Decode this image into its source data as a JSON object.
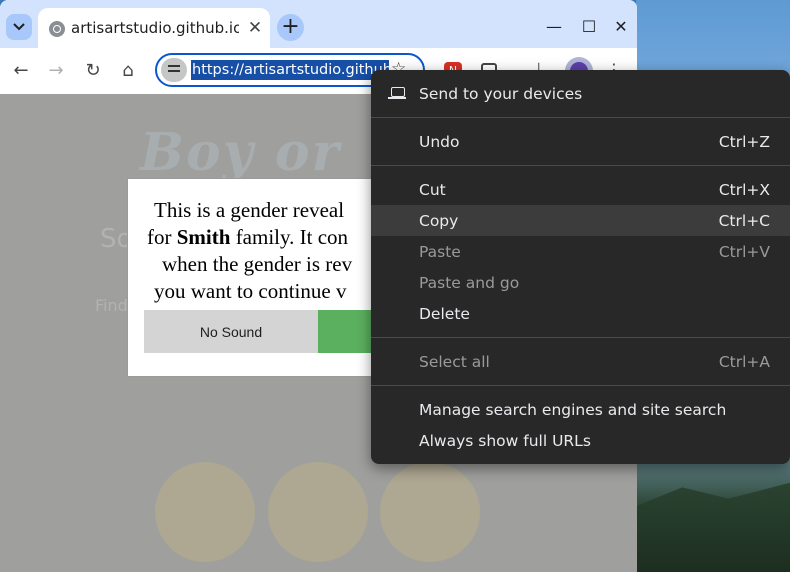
{
  "browser": {
    "tab": {
      "title": "artisartstudio.github.io/",
      "close_glyph": "✕"
    },
    "new_tab_glyph": "+",
    "window_controls": {
      "minimize": "—",
      "maximize": "☐",
      "close": "✕"
    },
    "nav": {
      "back": "←",
      "forward": "→",
      "reload": "↻",
      "home": "⌂"
    },
    "omnibox": {
      "url": "https://artisartstudio.github.io"
    },
    "icons": [
      "tab-search-icon",
      "site-info-icon",
      "bookmark-star-icon",
      "extension-icon",
      "puzzle-extensions-icon",
      "download-icon",
      "profile-avatar",
      "kebab-menu-icon"
    ]
  },
  "page": {
    "bg_logo": "Boy or",
    "ghost_heading": "So",
    "ghost_text": "Find",
    "modal": {
      "line1": "This is a gender reveal",
      "line2_pre": "for ",
      "line2_bold": "Smith",
      "line2_post": " family. It con",
      "line3": "when the gender is rev",
      "line4": "you want to continue v",
      "no_sound_label": "No Sound"
    }
  },
  "context_menu": {
    "send_to_devices": "Send to your devices",
    "items": [
      {
        "label": "Undo",
        "shortcut": "Ctrl+Z",
        "enabled": true
      },
      {
        "label": "Cut",
        "shortcut": "Ctrl+X",
        "enabled": true
      },
      {
        "label": "Copy",
        "shortcut": "Ctrl+C",
        "enabled": true,
        "highlighted": true
      },
      {
        "label": "Paste",
        "shortcut": "Ctrl+V",
        "enabled": false
      },
      {
        "label": "Paste and go",
        "shortcut": "",
        "enabled": false
      },
      {
        "label": "Delete",
        "shortcut": "",
        "enabled": true
      },
      {
        "label": "Select all",
        "shortcut": "Ctrl+A",
        "enabled": false
      },
      {
        "label": "Manage search engines and site search",
        "shortcut": "",
        "enabled": true
      },
      {
        "label": "Always show full URLs",
        "shortcut": "",
        "enabled": true
      }
    ]
  },
  "colors": {
    "accent": "#0b57d0",
    "menu_bg": "#282828",
    "tabstrip": "#d3e3fd",
    "sound_button": "#5bb05f"
  }
}
